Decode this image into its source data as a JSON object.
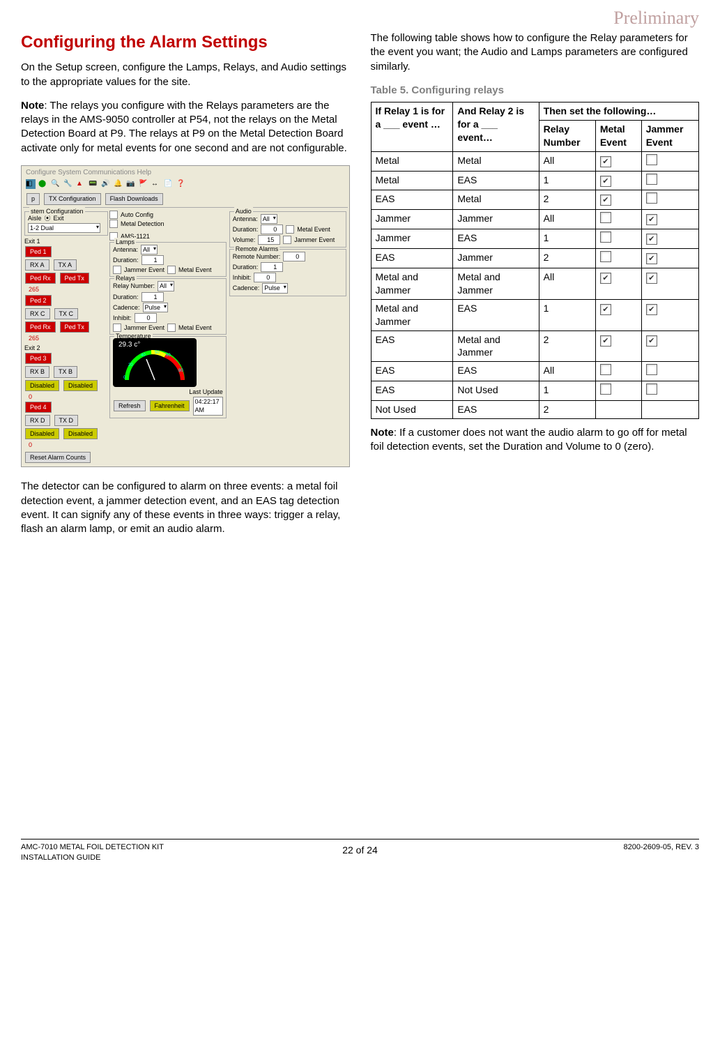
{
  "watermark": "Preliminary",
  "left": {
    "heading": "Configuring the Alarm Settings",
    "p1": "On the Setup screen, configure the Lamps, Relays, and Audio settings to the appropriate values for the site.",
    "note_label": "Note",
    "note_body": ": The relays you configure with the Relays parameters are the relays in the AMS-9050 controller at P54, not the relays on the Metal Detection Board at P9. The relays at P9 on the Metal Detection Board activate only for metal events for one second and are not configurable.",
    "p2": "The detector can be configured to alarm on three events: a metal foil detection event, a jammer detection event, and an EAS tag detection event. It can signify any of these events in three ways: trigger a relay, flash an alarm lamp, or emit an audio alarm.",
    "ui": {
      "menubar": "Configure   System   Communications   Help",
      "tabs": [
        "p",
        "TX Configuration",
        "Flash Downloads"
      ],
      "group_system": "stem Configuration",
      "aisle_label": "Aisle",
      "exit_radio": "Exit",
      "auto_config": "Auto Config",
      "metal_detection": "Metal Detection",
      "mode": "1-2 Dual",
      "exit_headers": [
        "Exit 1",
        "Exit 2"
      ],
      "peds": [
        "Ped 1",
        "Ped 2",
        "Ped 3",
        "Ped 4"
      ],
      "rx_tx": [
        [
          "RX A",
          "TX A",
          "Ped Rx",
          "Ped Tx",
          "265"
        ],
        [
          "RX C",
          "TX C",
          "Ped Rx",
          "Ped Tx",
          "265"
        ],
        [
          "RX B",
          "TX B",
          "Disabled",
          "Disabled",
          "0"
        ],
        [
          "RX D",
          "TX D",
          "Disabled",
          "Disabled",
          "0"
        ]
      ],
      "reset_btn": "Reset Alarm Counts",
      "ams": "AMS-1121",
      "lamps": {
        "title": "Lamps",
        "antenna": "Antenna:",
        "antenna_v": "All",
        "duration": "Duration:",
        "duration_v": "1",
        "jammer_cb": "Jammer Event",
        "metal_cb": "Metal Event"
      },
      "relays": {
        "title": "Relays",
        "number": "Relay Number:",
        "number_v": "All",
        "duration": "Duration:",
        "duration_v": "1",
        "cadence": "Cadence:",
        "cadence_v": "Pulse",
        "inhibit": "Inhibit:",
        "inhibit_v": "0",
        "jammer_cb": "Jammer Event",
        "metal_cb": "Metal Event"
      },
      "audio": {
        "title": "Audio",
        "antenna": "Antenna:",
        "antenna_v": "All",
        "duration": "Duration:",
        "duration_v": "0",
        "volume": "Volume:",
        "volume_v": "15",
        "metal_cb": "Metal Event",
        "jammer_cb": "Jammer Event"
      },
      "remote": {
        "title": "Remote Alarms",
        "number": "Remote Number:",
        "number_v": "0",
        "duration": "Duration:",
        "duration_v": "1",
        "inhibit": "Inhibit:",
        "inhibit_v": "0",
        "cadence": "Cadence:",
        "cadence_v": "Pulse"
      },
      "temp": {
        "title": "Temperature",
        "reading": "29.3 c°",
        "refresh": "Refresh",
        "unit": "Fahrenheit",
        "last": "Last Update",
        "time": "04:22:17 AM"
      }
    }
  },
  "right": {
    "p1": "The following table shows how to configure the Relay parameters for the event you want; the Audio and Lamps parameters are configured similarly.",
    "table_caption": "Table 5. Configuring relays",
    "headers": {
      "c1": "If Relay 1 is for a ___ event …",
      "c2": "And Relay 2 is for a ___ event…",
      "c3": "Then set the following…",
      "c3a": "Relay Number",
      "c3b": "Metal Event",
      "c3c": "Jammer Event"
    },
    "rows": [
      {
        "r1": "Metal",
        "r2": "Metal",
        "num": "All",
        "metal": "checked",
        "jammer": "unchecked"
      },
      {
        "r1": "Metal",
        "r2": "EAS",
        "num": "1",
        "metal": "checked",
        "jammer": "unchecked"
      },
      {
        "r1": "EAS",
        "r2": "Metal",
        "num": "2",
        "metal": "checked",
        "jammer": "unchecked"
      },
      {
        "r1": "Jammer",
        "r2": "Jammer",
        "num": "All",
        "metal": "unchecked",
        "jammer": "checked"
      },
      {
        "r1": "Jammer",
        "r2": "EAS",
        "num": "1",
        "metal": "unchecked",
        "jammer": "checked"
      },
      {
        "r1": "EAS",
        "r2": "Jammer",
        "num": "2",
        "metal": "unchecked",
        "jammer": "checked"
      },
      {
        "r1": "Metal and Jammer",
        "r2": "Metal and Jammer",
        "num": "All",
        "metal": "checked",
        "jammer": "checked"
      },
      {
        "r1": "Metal and Jammer",
        "r2": "EAS",
        "num": "1",
        "metal": "checked",
        "jammer": "checked"
      },
      {
        "r1": "EAS",
        "r2": "Metal and Jammer",
        "num": "2",
        "metal": "checked",
        "jammer": "checked"
      },
      {
        "r1": "EAS",
        "r2": "EAS",
        "num": "All",
        "metal": "unchecked",
        "jammer": "unchecked"
      },
      {
        "r1": "EAS",
        "r2": "Not Used",
        "num": "1",
        "metal": "unchecked",
        "jammer": "unchecked"
      },
      {
        "r1": "Not Used",
        "r2": "EAS",
        "num": "2",
        "metal": "",
        "jammer": ""
      }
    ],
    "note_label": "Note",
    "note_body": ": If a customer does not want the audio alarm to go off for metal foil detection events, set the Duration and Volume to 0 (zero)."
  },
  "footer": {
    "left1": "AMC-7010 METAL FOIL DETECTION KIT",
    "left2": "INSTALLATION GUIDE",
    "mid": "22 of 24",
    "right": "8200-2609-05, REV. 3"
  }
}
